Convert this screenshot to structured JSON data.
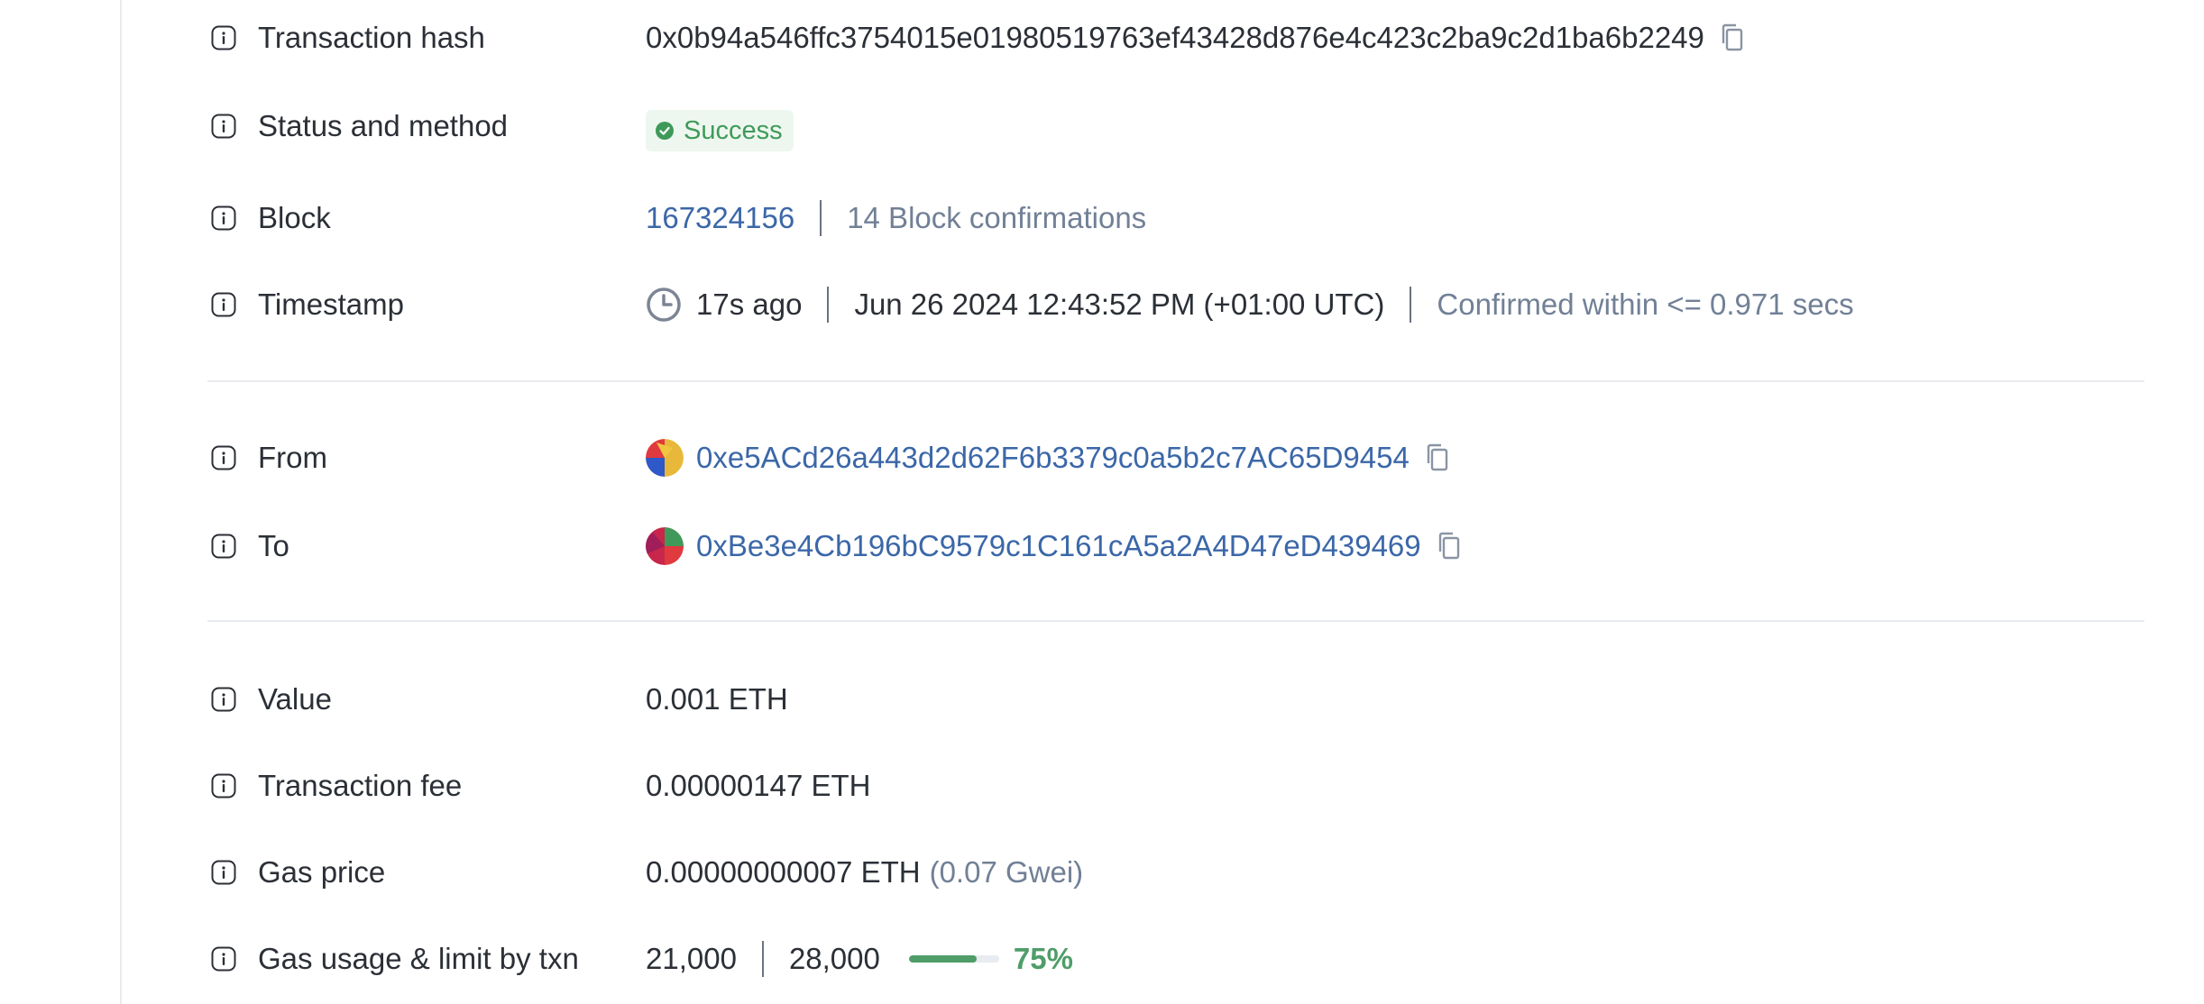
{
  "rows": {
    "hash": {
      "label": "Transaction hash",
      "value": "0x0b94a546ffc3754015e01980519763ef43428d876e4c423c2ba9c2d1ba6b2249"
    },
    "status": {
      "label": "Status and method",
      "badge": "Success"
    },
    "block": {
      "label": "Block",
      "number": "167324156",
      "confirmations": "14 Block confirmations"
    },
    "timestamp": {
      "label": "Timestamp",
      "ago": "17s ago",
      "datetime": "Jun 26 2024 12:43:52 PM (+01:00 UTC)",
      "confirmed": "Confirmed within <= 0.971 secs"
    },
    "from": {
      "label": "From",
      "address": "0xe5ACd26a443d2d62F6b3379c0a5b2c7AC65D9454"
    },
    "to": {
      "label": "To",
      "address": "0xBe3e4Cb196bC9579c1C161cA5a2A4D47eD439469"
    },
    "value": {
      "label": "Value",
      "amount": "0.001 ETH"
    },
    "fee": {
      "label": "Transaction fee",
      "amount": "0.00000147 ETH"
    },
    "gas_price": {
      "label": "Gas price",
      "amount": "0.00000000007 ETH",
      "gwei": "(0.07 Gwei)"
    },
    "gas_usage": {
      "label": "Gas usage & limit by txn",
      "used": "21,000",
      "limit": "28,000",
      "percent_label": "75%",
      "fraction": 0.75
    }
  },
  "icons": {
    "info": "info-icon",
    "copy": "copy-icon",
    "check": "check-circle-icon",
    "clock": "clock-icon",
    "avatar": "address-avatar"
  },
  "colors": {
    "link": "#3b67a8",
    "success": "#3f9a59",
    "muted": "#718096"
  }
}
